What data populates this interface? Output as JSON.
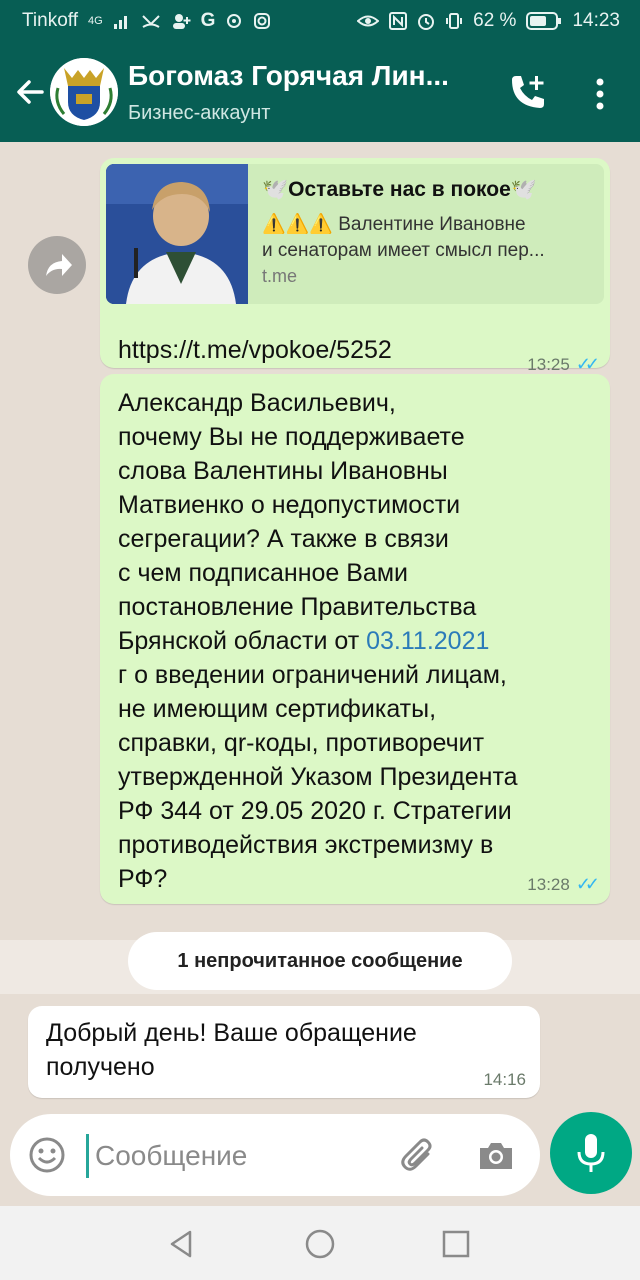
{
  "statusbar": {
    "carrier": "Tinkoff",
    "network": "4G",
    "battery": "62 %",
    "time": "14:23"
  },
  "header": {
    "title": "Богомаз Горячая Лин...",
    "subtitle": "Бизнес-аккаунт"
  },
  "messages": {
    "m1": {
      "preview_title": "🕊️Оставьте нас в покое🕊️",
      "preview_desc_1": "⚠️⚠️⚠️ Валентине Ивановне",
      "preview_desc_2": "и сенаторам имеет смысл пер...",
      "preview_domain": "t.me",
      "link": "https://t.me/vpokoe/5252",
      "time": "13:25"
    },
    "m2": {
      "lines": [
        "Александр Васильевич,",
        "почему Вы не поддерживаете",
        "слова Валентины Ивановны",
        "Матвиенко о недопустимости",
        "сегрегации? А также в связи",
        "с чем подписанное Вами",
        "постановление Правительства",
        "Брянской области от ",
        "г о введении ограничений лицам,",
        "не имеющим сертификаты,",
        "справки, qr-коды, противоречит",
        "утвержденной Указом Президента",
        "РФ 344 от 29.05 2020 г. Стратегии",
        "противодействия экстремизму в",
        "РФ?"
      ],
      "date_link": "03.11.2021",
      "time": "13:28"
    },
    "unread_label": "1 непрочитанное сообщение",
    "m3": {
      "line1": "Добрый день! Ваше обращение",
      "line2": "получено",
      "time": "14:16"
    }
  },
  "composer": {
    "placeholder": "Сообщение"
  },
  "colors": {
    "appbar": "#075e54",
    "outgoing_bubble": "#dcf8c6",
    "read_ticks": "#34b7f1",
    "mic_button": "#00a884"
  }
}
